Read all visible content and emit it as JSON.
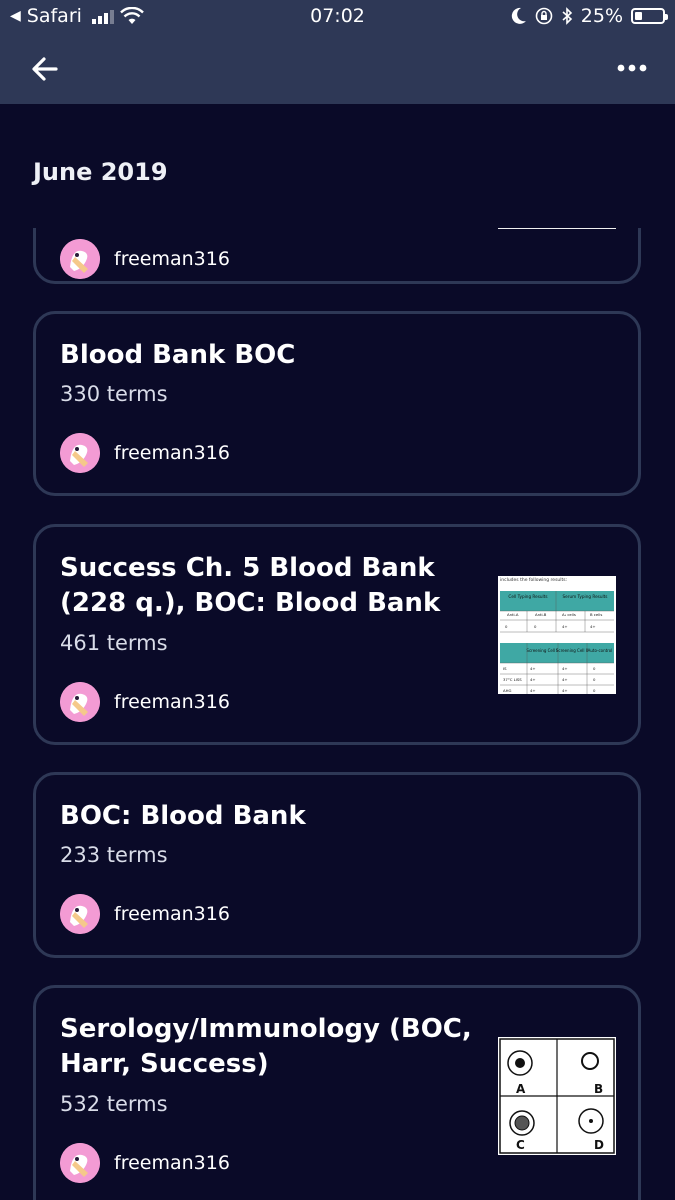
{
  "status_bar": {
    "back_app": "Safari",
    "time": "07:02",
    "battery": "25%",
    "battery_level": 0.25
  },
  "nav": {
    "back_icon": "arrow-left-icon",
    "more_icon": "ellipsis-icon"
  },
  "section": {
    "title": "June 2019"
  },
  "cards": [
    {
      "title": "",
      "terms": "",
      "author": "freeman316",
      "has_thumb": true
    },
    {
      "title": "Blood Bank BOC",
      "terms": "330 terms",
      "author": "freeman316",
      "has_thumb": false
    },
    {
      "title": "Success Ch. 5 Blood Bank (228 q.), BOC: Blood Bank",
      "terms": "461 terms",
      "author": "freeman316",
      "has_thumb": true
    },
    {
      "title": "BOC: Blood Bank",
      "terms": "233 terms",
      "author": "freeman316",
      "has_thumb": false
    },
    {
      "title": "Serology/Immunology (BOC, Harr, Success)",
      "terms": "532 terms",
      "author": "freeman316",
      "has_thumb": true
    }
  ],
  "thumb_blood": {
    "caption": "includes the following results:",
    "header1": [
      "Cell Typing Results",
      "Serum Typing Results"
    ],
    "sub1": [
      "Anti-A",
      "Anti-B",
      "A₁ cells",
      "B cells"
    ],
    "row1": [
      "0",
      "0",
      "4+",
      "4+"
    ],
    "header2": [
      "Screening Cell I",
      "Screening Cell II",
      "Auto-control"
    ],
    "rows2": [
      [
        "IS",
        "4+",
        "4+",
        "0"
      ],
      [
        "37°C LISS",
        "4+",
        "4+",
        "0"
      ],
      [
        "AHG",
        "4+",
        "4+",
        "0"
      ]
    ]
  },
  "thumb_sero": {
    "labels": [
      "A",
      "B",
      "C",
      "D"
    ]
  },
  "colors": {
    "background": "#0a0a28",
    "bar": "#2e3856",
    "card_border": "#2e3856",
    "avatar": "#f39bd4"
  }
}
